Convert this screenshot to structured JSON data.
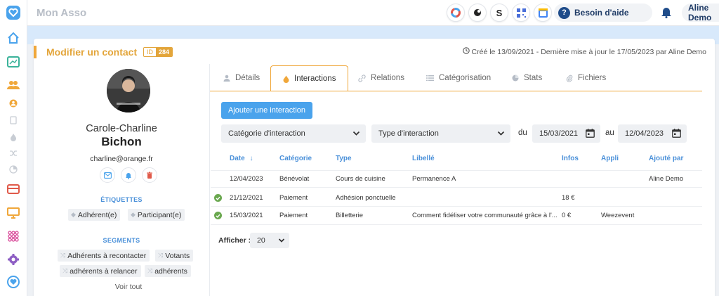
{
  "app": {
    "title": "Mon Asso"
  },
  "topbar": {
    "tools": [
      "color-wheel-icon",
      "mailchimp-icon",
      "stripe-icon",
      "qr-code-icon",
      "calendar-app-icon"
    ],
    "stripe_letter": "S",
    "help_label": "Besoin d'aide",
    "help_q": "?",
    "user_name": "Aline Demo"
  },
  "page": {
    "title": "Modifier un contact",
    "id_key": "ID",
    "id_value": "284",
    "meta": "Créé le 13/09/2021 - Dernière mise à jour le 17/05/2023 par Aline Demo"
  },
  "profile": {
    "first_name": "Carole-Charline",
    "last_name": "Bichon",
    "email": "charline@orange.fr",
    "tags_title": "ÉTIQUETTES",
    "tags": [
      "Adhérent(e)",
      "Participant(e)"
    ],
    "segments_title": "SEGMENTS",
    "segments": [
      "Adhérents à recontacter",
      "Votants",
      "adhérents à relancer",
      "adhérents"
    ],
    "see_all": "Voir tout"
  },
  "tabs": [
    {
      "label": "Détails",
      "icon": "user-icon"
    },
    {
      "label": "Interactions",
      "icon": "flame-icon",
      "active": true
    },
    {
      "label": "Relations",
      "icon": "link-icon"
    },
    {
      "label": "Catégorisation",
      "icon": "list-icon"
    },
    {
      "label": "Stats",
      "icon": "pie-chart-icon"
    },
    {
      "label": "Fichiers",
      "icon": "paperclip-icon"
    }
  ],
  "interactions": {
    "add_button": "Ajouter une interaction",
    "category_select": "Catégorie d'interaction",
    "type_select": "Type d'interaction",
    "from_label": "du",
    "from_date": "15/03/2021",
    "to_label": "au",
    "to_date": "12/04/2023",
    "columns": [
      "Date",
      "Catégorie",
      "Type",
      "Libellé",
      "Infos",
      "Appli",
      "Ajouté par"
    ],
    "sort_arrow": "↓",
    "rows": [
      {
        "status": "",
        "date": "12/04/2023",
        "category": "Bénévolat",
        "type": "Cours de cuisine",
        "label": "Permanence A",
        "infos": "",
        "app": "",
        "added_by": "Aline Demo"
      },
      {
        "status": "done",
        "date": "21/12/2021",
        "category": "Paiement",
        "type": "Adhésion ponctuelle",
        "label": "",
        "infos": "18 €",
        "app": "",
        "added_by": ""
      },
      {
        "status": "done",
        "date": "15/03/2021",
        "category": "Paiement",
        "type": "Billetterie",
        "label": "Comment fidéliser votre communauté grâce à l'...",
        "infos": "0 €",
        "app": "Weezevent",
        "added_by": ""
      }
    ],
    "per_page_label": "Afficher :",
    "per_page_value": "20"
  },
  "colors": {
    "accent": "#f0a73a",
    "primary": "#4aa3ec",
    "link": "#4a90d9",
    "success": "#6aa84f"
  }
}
